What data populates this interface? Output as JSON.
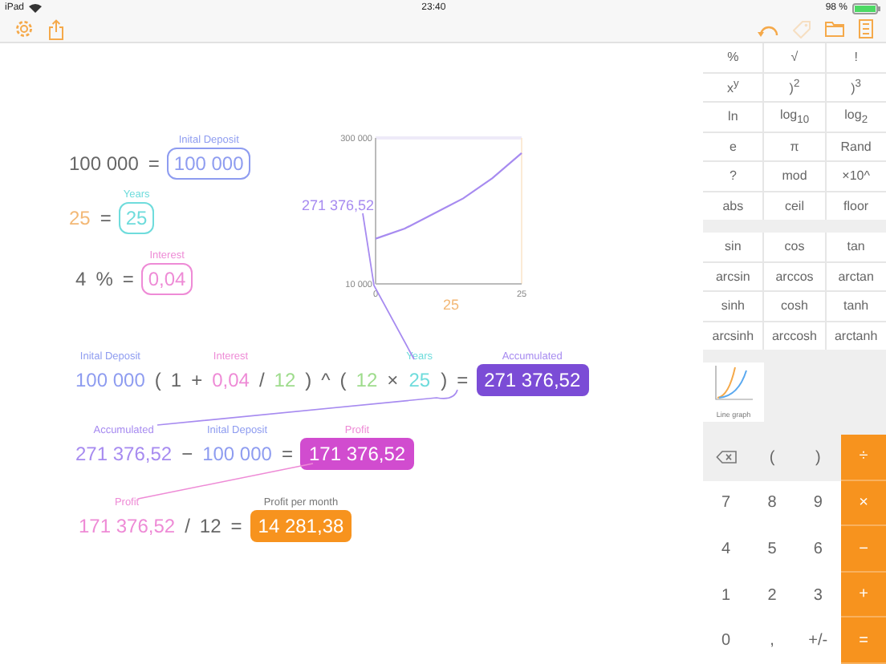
{
  "status_bar": {
    "carrier": "iPad",
    "time": "23:40",
    "battery": "98 %"
  },
  "toolbar": {
    "left": [
      {
        "kind": "settings",
        "disabled": false
      },
      {
        "kind": "share",
        "disabled": false
      }
    ],
    "right": [
      {
        "kind": "undo",
        "disabled": false
      },
      {
        "kind": "tag",
        "disabled": true
      },
      {
        "kind": "folder",
        "disabled": false
      },
      {
        "kind": "document",
        "disabled": false
      }
    ]
  },
  "equations": [
    {
      "tokens": [
        {
          "kind": "text",
          "text": "100 000"
        },
        {
          "kind": "op",
          "text": "="
        },
        {
          "kind": "box",
          "text": "100 000",
          "color": "#8e9cf0",
          "label": {
            "text": "Inital Deposit",
            "color": "#8e9cf0"
          }
        }
      ]
    },
    {
      "tokens": [
        {
          "kind": "text",
          "text": "25",
          "color": "#f3b876"
        },
        {
          "kind": "op",
          "text": "="
        },
        {
          "kind": "box",
          "text": "25",
          "color": "#6fdcdc",
          "label": {
            "text": "Years",
            "color": "#6fdcdc"
          }
        }
      ]
    },
    {
      "tokens": [
        {
          "kind": "text",
          "text": "4"
        },
        {
          "kind": "text",
          "text": "%"
        },
        {
          "kind": "op",
          "text": "="
        },
        {
          "kind": "box",
          "text": "0,04",
          "color": "#ee8bd6",
          "label": {
            "text": "Interest",
            "color": "#ee8bd6"
          }
        }
      ]
    },
    {
      "tokens": [
        {
          "kind": "text",
          "text": "100 000",
          "color": "#8e9cf0",
          "label": {
            "text": "Inital Deposit",
            "color": "#8e9cf0"
          }
        },
        {
          "kind": "op",
          "text": "("
        },
        {
          "kind": "text",
          "text": "1"
        },
        {
          "kind": "op",
          "text": "+"
        },
        {
          "kind": "text",
          "text": "0,04",
          "color": "#ee8bd6",
          "label": {
            "text": "Interest",
            "color": "#ee8bd6"
          }
        },
        {
          "kind": "op",
          "text": "/"
        },
        {
          "kind": "text",
          "text": "12",
          "color": "#9edc8c"
        },
        {
          "kind": "op",
          "text": ")"
        },
        {
          "kind": "op",
          "text": "^"
        },
        {
          "kind": "op",
          "text": "("
        },
        {
          "kind": "text",
          "text": "12",
          "color": "#9edc8c"
        },
        {
          "kind": "op",
          "text": "×"
        },
        {
          "kind": "text",
          "text": "25",
          "color": "#6fdcdc",
          "label": {
            "text": "Years",
            "color": "#6fdcdc"
          }
        },
        {
          "kind": "op",
          "text": ")"
        },
        {
          "kind": "op",
          "text": "="
        },
        {
          "kind": "result",
          "text": "271 376,52",
          "color": "#7b4cd6",
          "label": {
            "text": "Accumulated",
            "color": "#a78bf0"
          }
        }
      ]
    },
    {
      "tokens": [
        {
          "kind": "text",
          "text": "271 376,52",
          "color": "#a78bf0",
          "label": {
            "text": "Accumulated",
            "color": "#a78bf0"
          }
        },
        {
          "kind": "op",
          "text": "−"
        },
        {
          "kind": "text",
          "text": "100 000",
          "color": "#8e9cf0",
          "label": {
            "text": "Inital Deposit",
            "color": "#8e9cf0"
          }
        },
        {
          "kind": "op",
          "text": "="
        },
        {
          "kind": "result",
          "text": "171 376,52",
          "color": "#d14ccf",
          "label": {
            "text": "Profit",
            "color": "#ee8bd6"
          }
        }
      ]
    },
    {
      "tokens": [
        {
          "kind": "text",
          "text": "171 376,52",
          "color": "#ee8bd6",
          "label": {
            "text": "Profit",
            "color": "#ee8bd6"
          }
        },
        {
          "kind": "op",
          "text": "/"
        },
        {
          "kind": "text",
          "text": "12"
        },
        {
          "kind": "op",
          "text": "="
        },
        {
          "kind": "result",
          "text": "14 281,38",
          "color": "#f7931e",
          "label": {
            "text": "Profit per month",
            "color": "#777777"
          }
        }
      ]
    }
  ],
  "chart": {
    "chart_data": {
      "type": "line",
      "x": [
        0,
        5,
        10,
        15,
        20,
        25
      ],
      "xlim": [
        0,
        25
      ],
      "ylim": [
        10000,
        300000
      ],
      "xticks": [
        0,
        25
      ],
      "yticks": [
        {
          "value": 10000,
          "label": "10 000"
        },
        {
          "value": 300000,
          "label": "300 000"
        }
      ],
      "xlabel": "25",
      "ylabel": "271 376,52",
      "series": [
        {
          "color": "#a78bf0",
          "values": [
            100000,
            120000,
            150000,
            180000,
            220000,
            270000
          ]
        }
      ]
    }
  },
  "functions": [
    "%",
    "√",
    "!",
    "x$^{y}$",
    ")$^{2}$",
    ")$^{3}$",
    "ln",
    "log$_{10}$",
    "log$_{2}$",
    "e",
    "π",
    "Rand",
    "?",
    "mod",
    "×10^",
    "abs",
    "ceil",
    "floor"
  ],
  "trig": [
    "sin",
    "cos",
    "tan",
    "arcsin",
    "arccos",
    "arctan",
    "sinh",
    "cosh",
    "tanh",
    "arcsinh",
    "arccosh",
    "arctanh"
  ],
  "graph_tile": {
    "label": "Line graph"
  },
  "keypad": [
    {
      "kind": "delete"
    },
    {
      "kind": "gray",
      "text": "("
    },
    {
      "kind": "gray",
      "text": ")"
    },
    {
      "kind": "operator",
      "text": "÷"
    },
    {
      "kind": "digit",
      "text": "7"
    },
    {
      "kind": "digit",
      "text": "8"
    },
    {
      "kind": "digit",
      "text": "9"
    },
    {
      "kind": "operator",
      "text": "×"
    },
    {
      "kind": "digit",
      "text": "4"
    },
    {
      "kind": "digit",
      "text": "5"
    },
    {
      "kind": "digit",
      "text": "6"
    },
    {
      "kind": "operator",
      "text": "−"
    },
    {
      "kind": "digit",
      "text": "1"
    },
    {
      "kind": "digit",
      "text": "2"
    },
    {
      "kind": "digit",
      "text": "3"
    },
    {
      "kind": "operator",
      "text": "+"
    },
    {
      "kind": "digit",
      "text": "0"
    },
    {
      "kind": "digit",
      "text": ","
    },
    {
      "kind": "digit",
      "text": "+/-"
    },
    {
      "kind": "operator",
      "text": "="
    }
  ]
}
